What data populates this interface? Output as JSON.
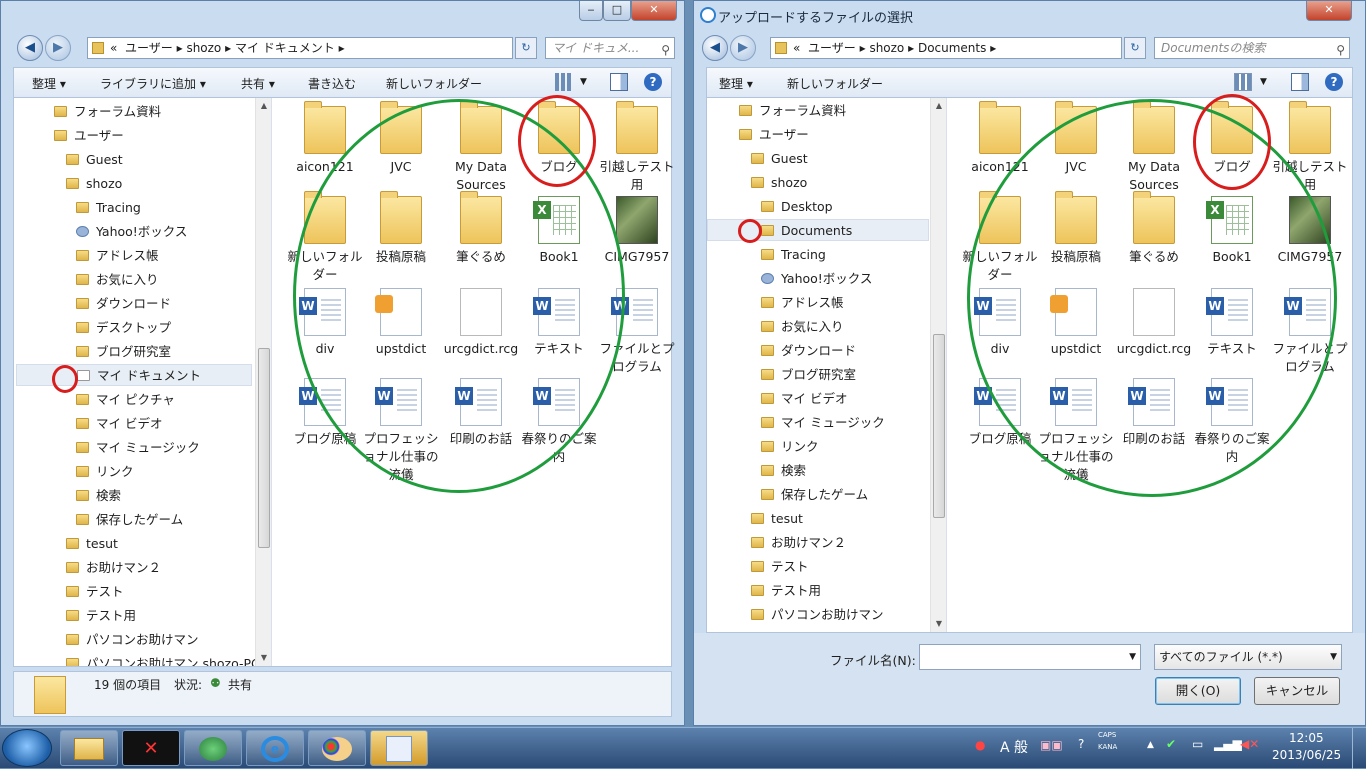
{
  "left": {
    "address": {
      "prefix": "«",
      "parts": [
        "ユーザー",
        "shozo",
        "マイ ドキュメント"
      ],
      "search_placeholder": "マイ ドキュメ..."
    },
    "toolbar": [
      "整理 ▾",
      "ライブラリに追加 ▾",
      "共有 ▾",
      "書き込む",
      "新しいフォルダー"
    ],
    "nav": [
      "フォーラム資料",
      "ユーザー",
      "Guest",
      "shozo",
      "Tracing",
      "Yahoo!ボックス",
      "アドレス帳",
      "お気に入り",
      "ダウンロード",
      "デスクトップ",
      "ブログ研究室",
      "マイ ドキュメント",
      "マイ ピクチャ",
      "マイ ビデオ",
      "マイ ミュージック",
      "リンク",
      "検索",
      "保存したゲーム",
      "tesut",
      "お助けマン２",
      "テスト",
      "テスト用",
      "パソコンお助けマン",
      "パソコンお助けマン shozo-PC"
    ],
    "files": [
      "aicon121",
      "JVC",
      "My Data Sources",
      "ブログ",
      "引越しテスト用",
      "新しいフォルダー",
      "投稿原稿",
      "筆ぐるめ",
      "Book1",
      "CIMG7957",
      "div",
      "upstdict",
      "urcgdict.rcg",
      "テキスト",
      "ファイルとプログラム",
      "ブログ原稿",
      "プロフェッショナル仕事の流儀",
      "印刷のお話",
      "春祭りのご案内"
    ],
    "status": {
      "count": "19 個の項目",
      "state_label": "状況:",
      "state": "共有"
    }
  },
  "right": {
    "title": "アップロードするファイルの選択",
    "address": {
      "prefix": "«",
      "parts": [
        "ユーザー",
        "shozo",
        "Documents"
      ],
      "search_placeholder": "Documentsの検索"
    },
    "toolbar": [
      "整理 ▾",
      "新しいフォルダー"
    ],
    "nav": [
      "フォーラム資料",
      "ユーザー",
      "Guest",
      "shozo",
      "Desktop",
      "Documents",
      "Tracing",
      "Yahoo!ボックス",
      "アドレス帳",
      "お気に入り",
      "ダウンロード",
      "ブログ研究室",
      "マイ ビデオ",
      "マイ ミュージック",
      "リンク",
      "検索",
      "保存したゲーム",
      "tesut",
      "お助けマン２",
      "テスト",
      "テスト用",
      "パソコンお助けマン"
    ],
    "files": [
      "aicon121",
      "JVC",
      "My Data Sources",
      "ブログ",
      "引越しテスト用",
      "新しいフォルダー",
      "投稿原稿",
      "筆ぐるめ",
      "Book1",
      "CIMG7957",
      "div",
      "upstdict",
      "urcgdict.rcg",
      "テキスト",
      "ファイルとプログラム",
      "ブログ原稿",
      "プロフェッショナル仕事の流儀",
      "印刷のお話",
      "春祭りのご案内"
    ],
    "filename_label": "ファイル名(N):",
    "filename_value": "",
    "filter": "すべてのファイル (*.*)",
    "open": "開く(O)",
    "cancel": "キャンセル"
  },
  "taskbar": {
    "ime": "A 般",
    "caps": "CAPS",
    "kana": "KANA",
    "time": "12:05",
    "date": "2013/06/25"
  }
}
